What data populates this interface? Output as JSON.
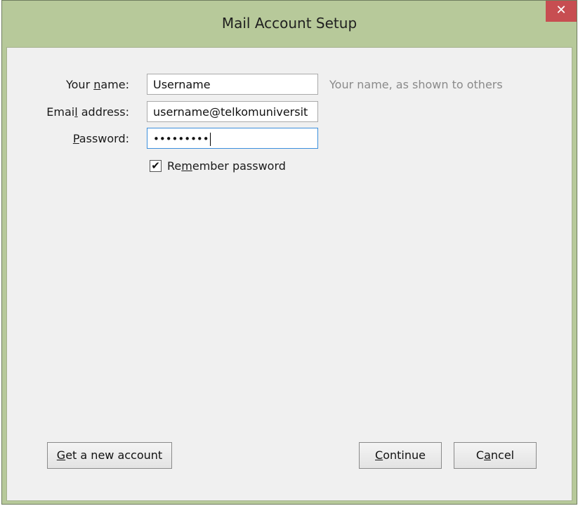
{
  "window": {
    "title": "Mail Account Setup",
    "close_glyph": "✕"
  },
  "form": {
    "name": {
      "label_pre": "Your ",
      "label_acc": "n",
      "label_post": "ame:",
      "value": "Username",
      "hint": "Your name, as shown to others"
    },
    "email": {
      "label_pre": "Emai",
      "label_acc": "l",
      "label_post": " address:",
      "value": "username@telkomuniversit"
    },
    "password": {
      "label_pre": "",
      "label_acc": "P",
      "label_post": "assword:",
      "value": "•••••••••"
    },
    "remember": {
      "checked": true,
      "check_glyph": "✔",
      "label_pre": "Re",
      "label_acc": "m",
      "label_post": "ember password"
    }
  },
  "buttons": {
    "new_account": {
      "pre": "",
      "acc": "G",
      "post": "et a new account"
    },
    "continue": {
      "pre": "",
      "acc": "C",
      "post": "ontinue"
    },
    "cancel": {
      "pre": "C",
      "acc": "a",
      "post": "ncel"
    }
  },
  "colors": {
    "titlebar": "#b7c99a",
    "close": "#c74e51",
    "client": "#f0f0f0",
    "focus_border": "#3c8fdc"
  }
}
